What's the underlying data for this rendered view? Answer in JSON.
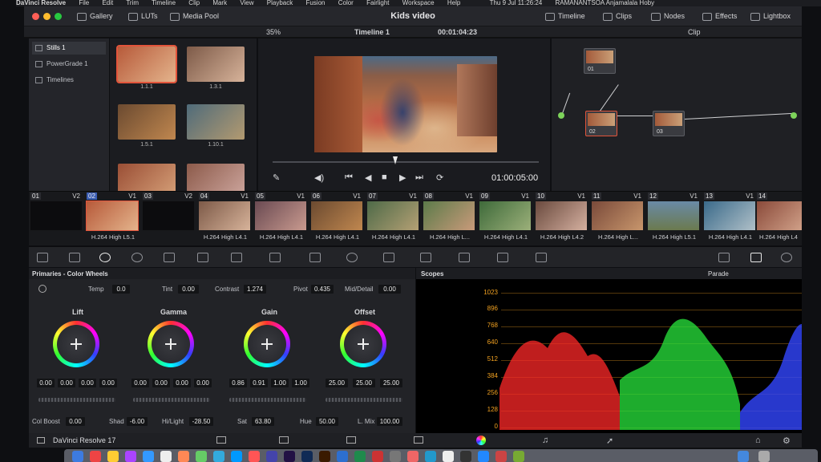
{
  "menubar": {
    "items": [
      "DaVinci Resolve",
      "File",
      "Edit",
      "Trim",
      "Timeline",
      "Clip",
      "Mark",
      "View",
      "Playback",
      "Fusion",
      "Color",
      "Fairlight",
      "Workspace",
      "Help"
    ],
    "clock": "Thu 9 Jul  11:26:24",
    "user": "RAMANANTSOA Anjamalala Hoby"
  },
  "topbar": {
    "app_title": "Kids video",
    "gallery": "Gallery",
    "luts": "LUTs",
    "media_pool": "Media Pool",
    "timeline": "Timeline",
    "clips": "Clips",
    "nodes": "Nodes",
    "effects": "Effects",
    "lightbox": "Lightbox"
  },
  "toolbar2": {
    "zoom": "35%",
    "timeline_name": "Timeline 1",
    "timecode": "00:01:04:23",
    "clip_mode": "Clip"
  },
  "gallery": {
    "side_items": [
      "Stills 1",
      "PowerGrade 1",
      "Timelines"
    ],
    "stills": [
      "1.1.1",
      "1.3.1",
      "1.5.1",
      "1.10.1"
    ]
  },
  "viewer": {
    "timecode_out": "01:00:05:00"
  },
  "nodes": {
    "items": [
      "01",
      "02",
      "03"
    ]
  },
  "clips": [
    {
      "num": "01",
      "track": "V2",
      "codec": ""
    },
    {
      "num": "02",
      "track": "V1",
      "codec": "H.264 High L5.1"
    },
    {
      "num": "03",
      "track": "V2",
      "codec": ""
    },
    {
      "num": "04",
      "track": "V1",
      "codec": "H.264 High L4.1"
    },
    {
      "num": "05",
      "track": "V1",
      "codec": "H.264 High L4.1"
    },
    {
      "num": "06",
      "track": "V1",
      "codec": "H.264 High L4.1"
    },
    {
      "num": "07",
      "track": "V1",
      "codec": "H.264 High L4.1"
    },
    {
      "num": "08",
      "track": "V1",
      "codec": "H.264 High L..."
    },
    {
      "num": "09",
      "track": "V1",
      "codec": "H.264 High L4.1"
    },
    {
      "num": "10",
      "track": "V1",
      "codec": "H.264 High L4.2"
    },
    {
      "num": "11",
      "track": "V1",
      "codec": "H.264 High L..."
    },
    {
      "num": "12",
      "track": "V1",
      "codec": "H.264 High L5.1"
    },
    {
      "num": "13",
      "track": "V1",
      "codec": "H.264 High L4.1"
    },
    {
      "num": "14",
      "track": "",
      "codec": "H.264 High L4"
    }
  ],
  "primaries": {
    "title": "Primaries - Color Wheels",
    "temp_label": "Temp",
    "temp": "0.0",
    "tint_label": "Tint",
    "tint": "0.00",
    "contrast_label": "Contrast",
    "contrast": "1.274",
    "pivot_label": "Pivot",
    "pivot": "0.435",
    "middetail_label": "Mid/Detail",
    "middetail": "0.00",
    "lift": {
      "label": "Lift",
      "values": [
        "0.00",
        "0.00",
        "0.00",
        "0.00"
      ]
    },
    "gamma": {
      "label": "Gamma",
      "values": [
        "0.00",
        "0.00",
        "0.00",
        "0.00"
      ]
    },
    "gain": {
      "label": "Gain",
      "values": [
        "0.86",
        "0.91",
        "1.00",
        "1.00"
      ]
    },
    "offset": {
      "label": "Offset",
      "values": [
        "25.00",
        "25.00",
        "25.00"
      ]
    },
    "colboost_label": "Col Boost",
    "colboost": "0.00",
    "shad_label": "Shad",
    "shad": "-6.00",
    "hilight_label": "Hi/Light",
    "hilight": "-28.50",
    "sat_label": "Sat",
    "sat": "63.80",
    "hue_label": "Hue",
    "hue": "50.00",
    "lmix_label": "L. Mix",
    "lmix": "100.00"
  },
  "scopes": {
    "title": "Scopes",
    "mode": "Parade",
    "scale": [
      "1023",
      "896",
      "768",
      "640",
      "512",
      "384",
      "256",
      "128",
      "0"
    ]
  },
  "bottombar": {
    "brand": "DaVinci Resolve 17"
  }
}
